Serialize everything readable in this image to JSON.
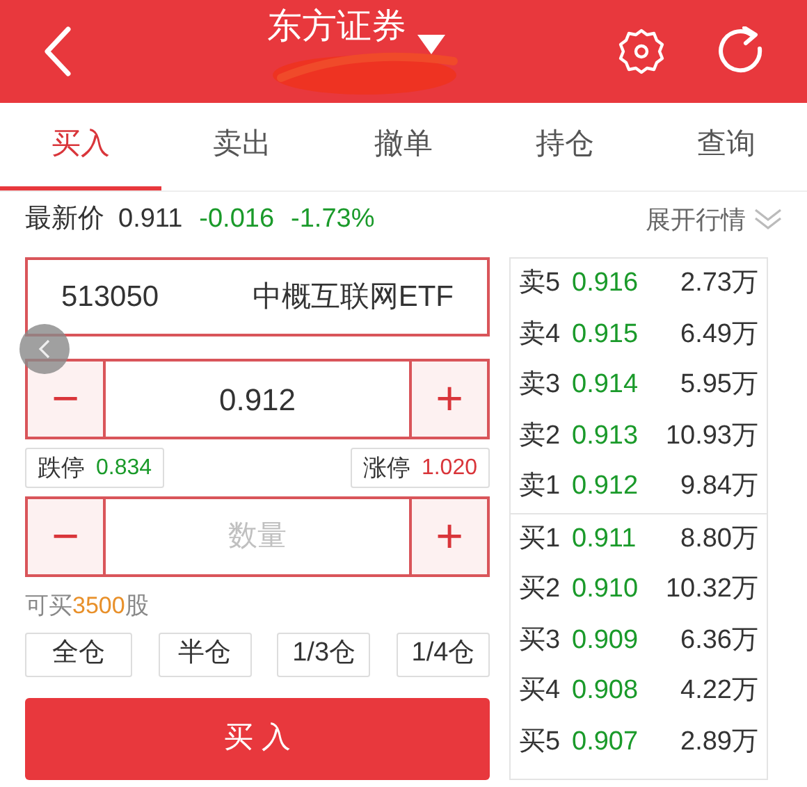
{
  "header": {
    "title": "东方证券"
  },
  "tabs": [
    {
      "label": "买入",
      "selected": true
    },
    {
      "label": "卖出",
      "selected": false
    },
    {
      "label": "撤单",
      "selected": false
    },
    {
      "label": "持仓",
      "selected": false
    },
    {
      "label": "查询",
      "selected": false
    }
  ],
  "quote": {
    "label": "最新价",
    "price": "0.911",
    "change": "-0.016",
    "percent": "-1.73%",
    "falling": true,
    "expand_label": "展开行情"
  },
  "stock": {
    "code": "513050",
    "name": "中概互联网ETF"
  },
  "price_field": {
    "value": "0.912",
    "minus": "−",
    "plus": "+"
  },
  "limits": [
    {
      "label": "跌停",
      "value": "0.834",
      "kind": "down"
    },
    {
      "label": "涨停",
      "value": "1.020",
      "kind": "up"
    }
  ],
  "quantity_field": {
    "placeholder": "数量",
    "minus": "−",
    "plus": "+"
  },
  "available": {
    "prefix": "可买",
    "amount": "3500",
    "suffix": "股"
  },
  "position_buttons": [
    "全仓",
    "半仓",
    "1/3仓",
    "1/4仓"
  ],
  "buy_button": "买 入",
  "order_book": {
    "asks": [
      {
        "label": "卖5",
        "price": "0.916",
        "volume": "2.73万"
      },
      {
        "label": "卖4",
        "price": "0.915",
        "volume": "6.49万"
      },
      {
        "label": "卖3",
        "price": "0.914",
        "volume": "5.95万"
      },
      {
        "label": "卖2",
        "price": "0.913",
        "volume": "10.93万"
      },
      {
        "label": "卖1",
        "price": "0.912",
        "volume": "9.84万"
      }
    ],
    "bids": [
      {
        "label": "买1",
        "price": "0.911",
        "volume": "8.80万"
      },
      {
        "label": "买2",
        "price": "0.910",
        "volume": "10.32万"
      },
      {
        "label": "买3",
        "price": "0.909",
        "volume": "6.36万"
      },
      {
        "label": "买4",
        "price": "0.908",
        "volume": "4.22万"
      },
      {
        "label": "买5",
        "price": "0.907",
        "volume": "2.89万"
      }
    ]
  }
}
